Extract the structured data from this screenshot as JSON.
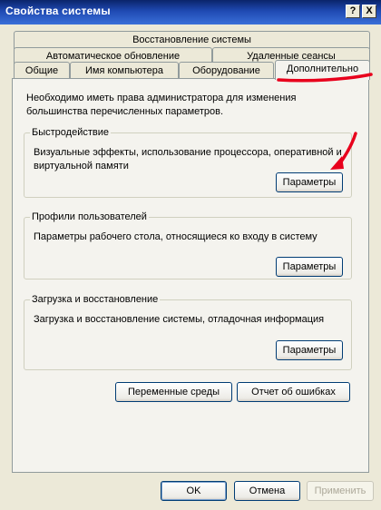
{
  "window": {
    "title": "Свойства системы",
    "help_glyph": "?",
    "close_glyph": "X"
  },
  "tabs": {
    "row1": [
      "Восстановление системы"
    ],
    "row2": [
      "Автоматическое обновление",
      "Удаленные сеансы"
    ],
    "row3": [
      "Общие",
      "Имя компьютера",
      "Оборудование",
      "Дополнительно"
    ],
    "active": "Дополнительно"
  },
  "advanced": {
    "intro": "Необходимо иметь права администратора для изменения большинства перечисленных параметров.",
    "performance": {
      "title": "Быстродействие",
      "description": "Визуальные эффекты, использование процессора, оперативной и виртуальной памяти",
      "button": "Параметры"
    },
    "profiles": {
      "title": "Профили пользователей",
      "description": "Параметры рабочего стола, относящиеся ко входу в систему",
      "button": "Параметры"
    },
    "startup": {
      "title": "Загрузка и восстановление",
      "description": "Загрузка и восстановление системы, отладочная информация",
      "button": "Параметры"
    },
    "env_button": "Переменные среды",
    "error_report_button": "Отчет об ошибках"
  },
  "footer": {
    "ok": "OK",
    "cancel": "Отмена",
    "apply": "Применить"
  },
  "colors": {
    "titlebar": "#0a246a",
    "dialog_bg": "#ece9d8",
    "annotation": "#e8001c"
  }
}
